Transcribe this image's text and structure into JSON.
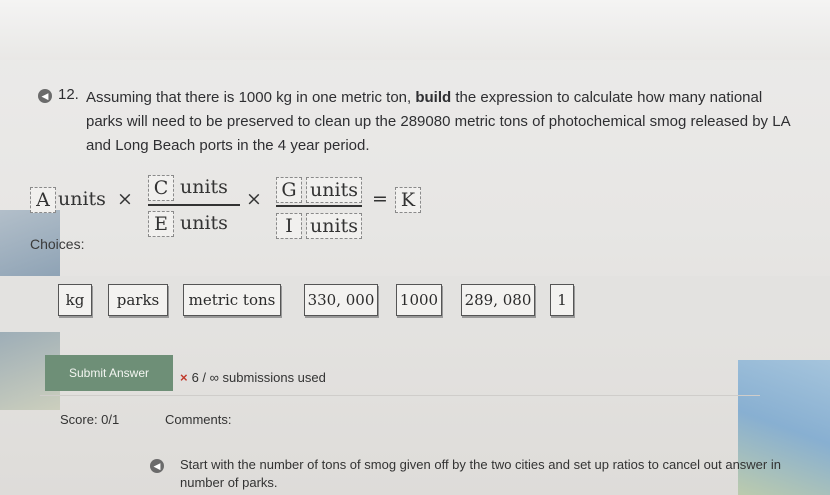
{
  "question": {
    "number": "12.",
    "text_part1": "Assuming that there is 1000 kg in one metric ton, ",
    "text_bold": "build",
    "text_part2": " the expression to calculate how many national parks will need to be preserved to clean up the 289080 metric tons of photochemical smog released by LA and Long Beach ports in the 4 year period."
  },
  "expression": {
    "box_A": "A",
    "units1": "units",
    "times1": "×",
    "box_C": "C",
    "units2": "units",
    "box_E": "E",
    "units3": "units",
    "times2": "×",
    "box_G": "G",
    "units4": "units",
    "box_I": "I",
    "units5": "units",
    "equals": "=",
    "box_K": "K"
  },
  "choices": {
    "label": "Choices:",
    "tiles": [
      "kg",
      "parks",
      "metric tons",
      "330, 000",
      "1000",
      "289, 080",
      "1"
    ]
  },
  "submission": {
    "submit_label": "Submit Answer",
    "x_mark": "×",
    "used_text": "6 / ∞ submissions used"
  },
  "score": {
    "label": "Score: 0/1"
  },
  "comments": {
    "label": "Comments:",
    "text": "Start with the number of tons of smog given off by the two cities and  set up ratios to cancel out answer in number of parks."
  }
}
